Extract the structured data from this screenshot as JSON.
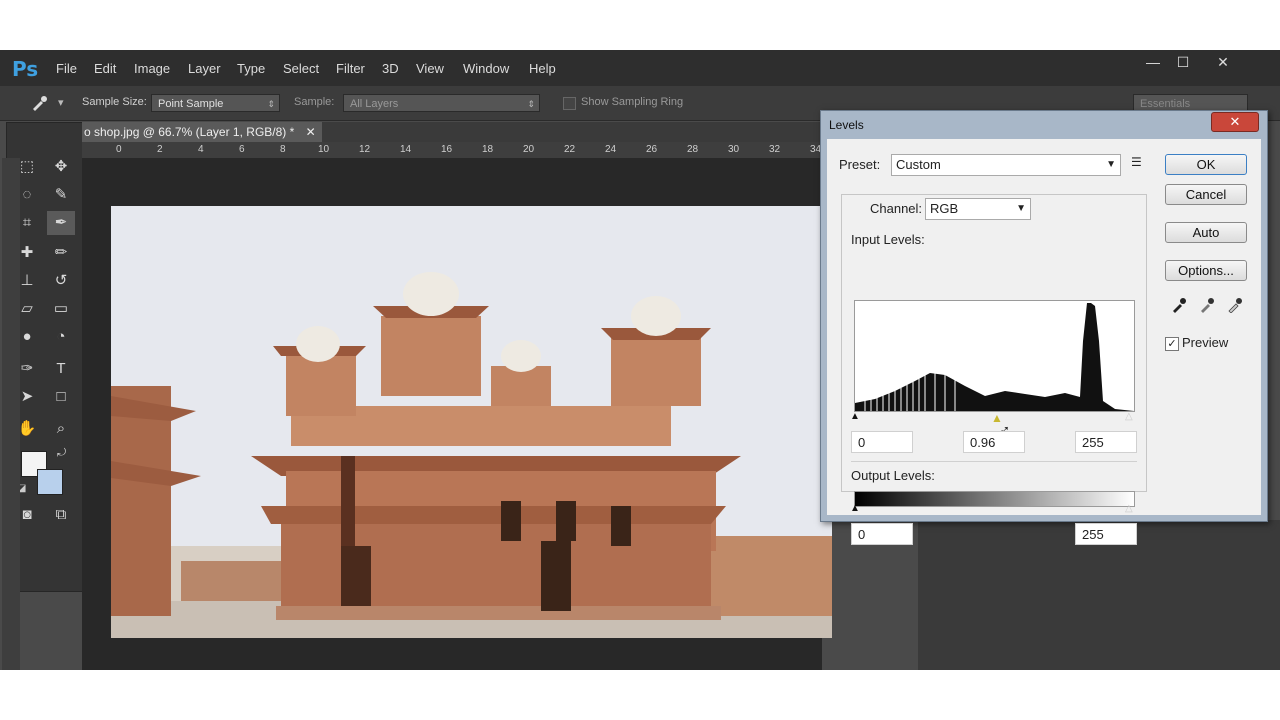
{
  "app": {
    "logo": "Ps"
  },
  "menu": {
    "items": [
      "File",
      "Edit",
      "Image",
      "Layer",
      "Type",
      "Select",
      "Filter",
      "3D",
      "View",
      "Window",
      "Help"
    ]
  },
  "window_controls": {
    "minimize": "—",
    "maximize": "☐",
    "close": "✕"
  },
  "options_bar": {
    "sample_size_label": "Sample Size:",
    "sample_size_value": "Point Sample",
    "sample_label": "Sample:",
    "sample_value": "All Layers",
    "show_sampling_ring": "Show Sampling Ring",
    "workspace": "Essentials"
  },
  "document": {
    "tab_title": "o shop.jpg @ 66.7% (Layer 1, RGB/8) *",
    "ruler_ticks": [
      "0",
      "2",
      "4",
      "6",
      "8",
      "10",
      "12",
      "14",
      "16",
      "18",
      "20",
      "22",
      "24",
      "26",
      "28",
      "30",
      "32",
      "34"
    ]
  },
  "levels_dialog": {
    "title": "Levels",
    "close": "✕",
    "preset_label": "Preset:",
    "preset_value": "Custom",
    "channel_label": "Channel:",
    "channel_value": "RGB",
    "input_levels_label": "Input Levels:",
    "input_black": "0",
    "input_gamma": "0.96",
    "input_white": "255",
    "output_levels_label": "Output Levels:",
    "output_black": "0",
    "output_white": "255",
    "buttons": {
      "ok": "OK",
      "cancel": "Cancel",
      "auto": "Auto",
      "options": "Options..."
    },
    "preview_label": "Preview",
    "preview_checked": true
  },
  "colors": {
    "accent": "#3fa0e0",
    "dialog_frame": "#a8b7c8",
    "close_red": "#c9473a"
  }
}
